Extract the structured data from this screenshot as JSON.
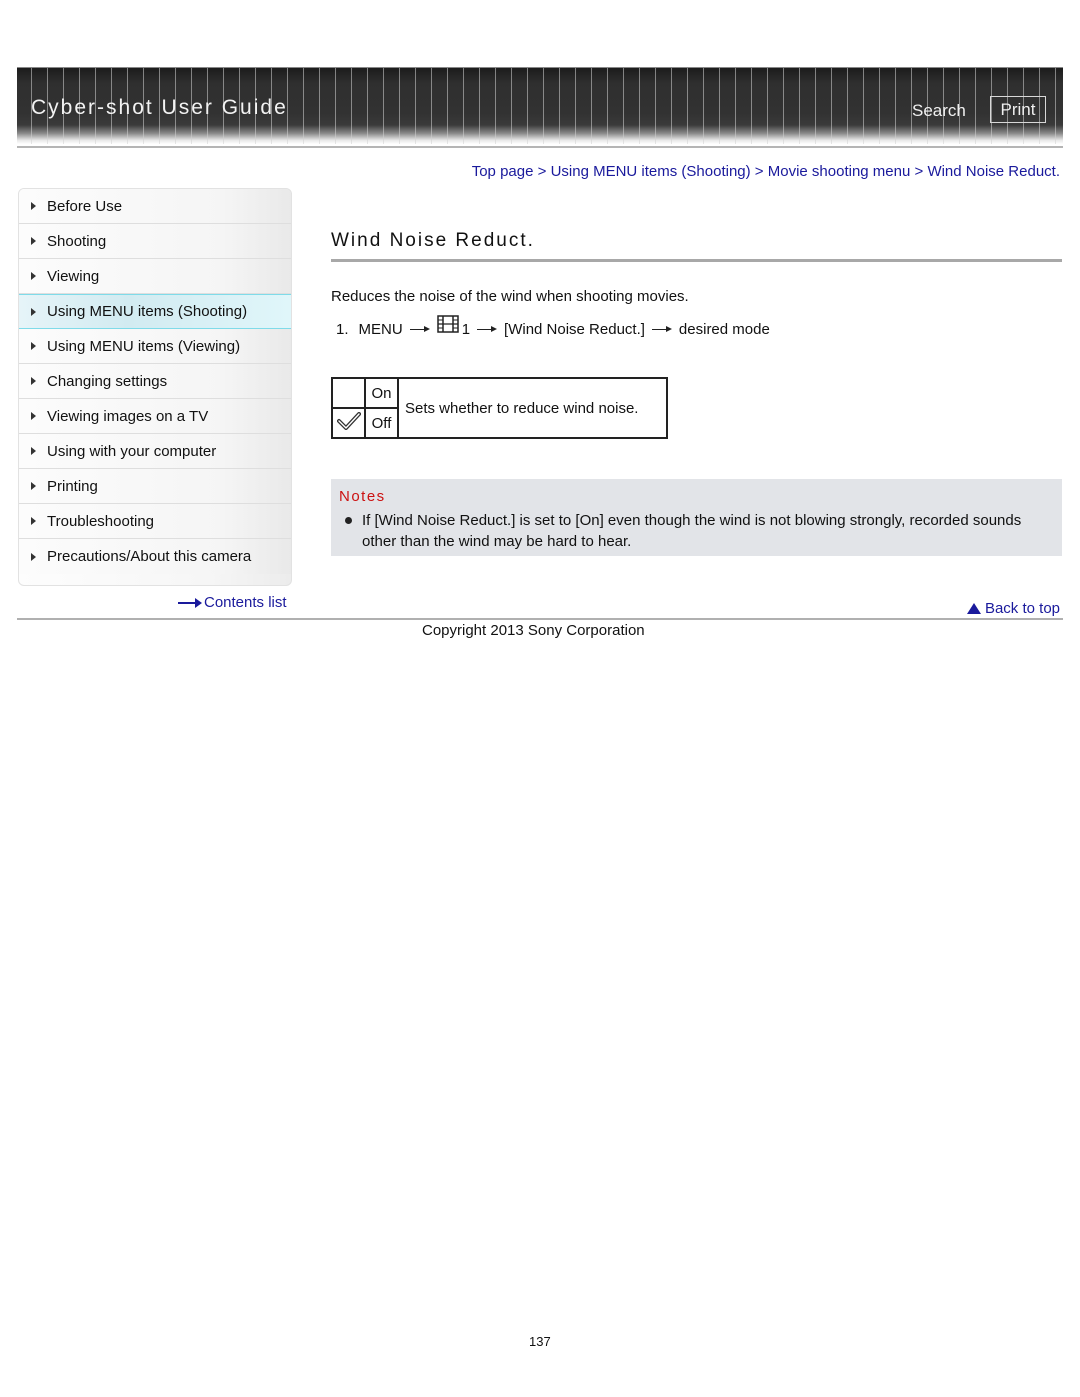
{
  "header": {
    "site_title": "Cyber-shot User Guide",
    "search_label": "Search",
    "print_label": "Print"
  },
  "breadcrumb": {
    "items": [
      "Top page",
      "Using MENU items (Shooting)",
      "Movie shooting menu",
      "Wind Noise Reduct."
    ],
    "separator": ">"
  },
  "sidebar": {
    "items": [
      {
        "label": "Before Use"
      },
      {
        "label": "Shooting"
      },
      {
        "label": "Viewing"
      },
      {
        "label": "Using MENU items (Shooting)",
        "active": true
      },
      {
        "label": "Using MENU items (Viewing)"
      },
      {
        "label": "Changing settings"
      },
      {
        "label": "Viewing images on a TV"
      },
      {
        "label": "Using with your computer"
      },
      {
        "label": "Printing"
      },
      {
        "label": "Troubleshooting"
      },
      {
        "label": "Precautions/About this camera"
      }
    ],
    "contents_list_label": "Contents list"
  },
  "main": {
    "title": "Wind Noise Reduct.",
    "intro": "Reduces the noise of the wind when shooting movies.",
    "step": {
      "number": "1.",
      "menu": "MENU",
      "icon": "movie-film-icon",
      "tab_number": "1",
      "item": "[Wind Noise Reduct.]",
      "result": "desired mode"
    },
    "modes": [
      {
        "name": "On",
        "default": false
      },
      {
        "name": "Off",
        "default": true
      }
    ],
    "modes_description": "Sets whether to reduce wind noise.",
    "notes": {
      "title": "Notes",
      "items": [
        "If [Wind Noise Reduct.] is set to [On] even though the wind is not blowing strongly, recorded sounds other than the wind may be hard to hear."
      ]
    },
    "back_to_top_label": "Back to top"
  },
  "footer": {
    "copyright": "Copyright 2013 Sony Corporation",
    "page_number": "137"
  },
  "colors": {
    "link": "#1a1a9c",
    "notes_title": "#cc1111",
    "notes_bg": "#e2e4e8",
    "active_nav_border": "#7fdbe9"
  }
}
